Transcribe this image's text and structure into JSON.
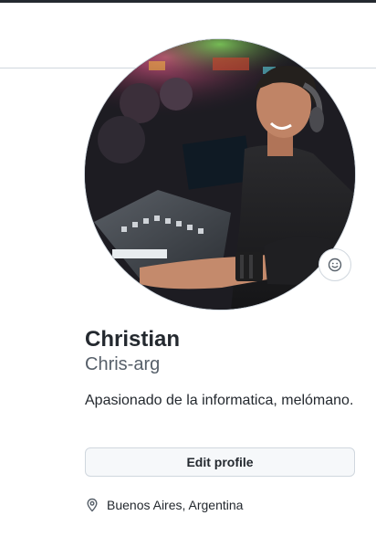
{
  "profile": {
    "display_name": "Christian",
    "username": "Chris-arg",
    "bio": "Apasionado de la informatica, melómano.",
    "edit_label": "Edit profile",
    "location": "Buenos Aires, Argentina"
  },
  "icons": {
    "status": "smiley-icon",
    "location": "location-pin-icon"
  },
  "colors": {
    "text_primary": "#24292f",
    "text_muted": "#57606a",
    "border": "#d0d7de",
    "button_bg": "#f6f8fa"
  }
}
